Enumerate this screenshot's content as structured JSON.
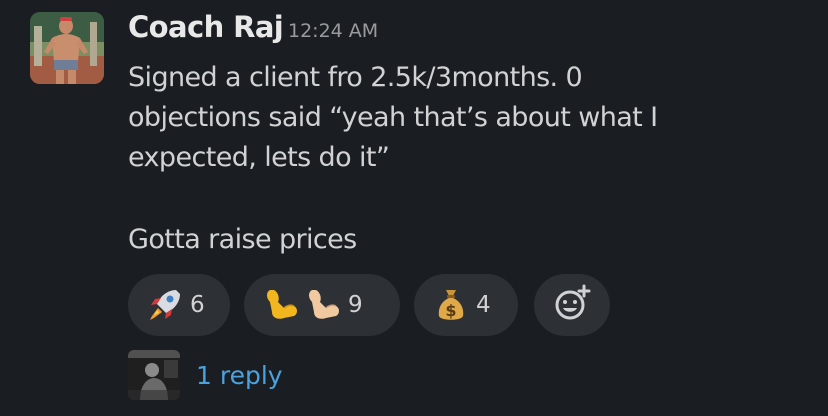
{
  "message": {
    "author": "Coach Raj",
    "timestamp": "12:24 AM",
    "lines": [
      "Signed a client fro 2.5k/3months. 0",
      "objections said “yeah that’s about what I",
      "expected, lets do it”",
      "Gotta raise prices"
    ]
  },
  "reactions": [
    {
      "icon": "rocket-icon",
      "count": "6"
    },
    {
      "icon": "flexed-biceps-icon",
      "count": "9"
    },
    {
      "icon": "money-bag-icon",
      "count": "4"
    }
  ],
  "add_reaction_icon": "add-reaction-icon",
  "thread": {
    "reply_label": "1 reply"
  },
  "colors": {
    "background": "#1a1d21",
    "pill": "#2d3034",
    "link": "#4aa3df"
  }
}
